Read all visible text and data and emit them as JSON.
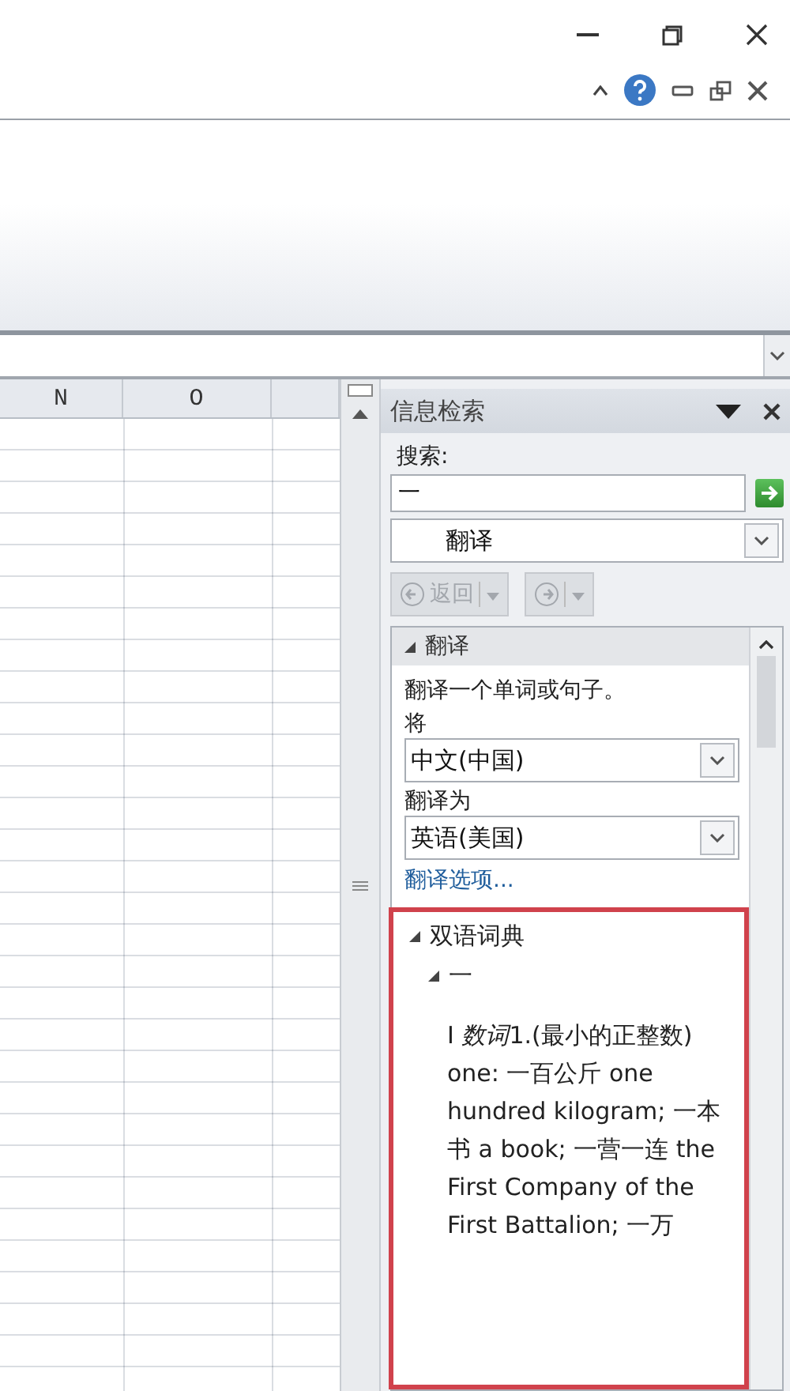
{
  "spreadsheet": {
    "columns": [
      "N",
      "O"
    ]
  },
  "research_pane": {
    "title": "信息检索",
    "search_label": "搜索:",
    "search_value": "一",
    "service": "翻译",
    "back_button": {
      "label": "返回",
      "disabled": true
    },
    "forward_button": {
      "disabled": true
    },
    "results": {
      "section": {
        "title": "翻译",
        "expanded": true
      },
      "instruction": "翻译一个单词或句子。",
      "from_label": "将",
      "from_value": "中文(中国)",
      "to_label": "翻译为",
      "to_value": "英语(美国)",
      "options_link": "翻译选项...",
      "dictionary": {
        "title": "双语词典",
        "expanded": true,
        "entry": {
          "headword": "一",
          "expanded": true,
          "definition": {
            "number": "I",
            "part_of_speech": "数词",
            "text": "1.(最小的正整数) one: 一百公斤 one hundred kilogram; 一本书 a book; 一营一连 the First Company of the First Battalion; 一万"
          }
        }
      }
    }
  }
}
